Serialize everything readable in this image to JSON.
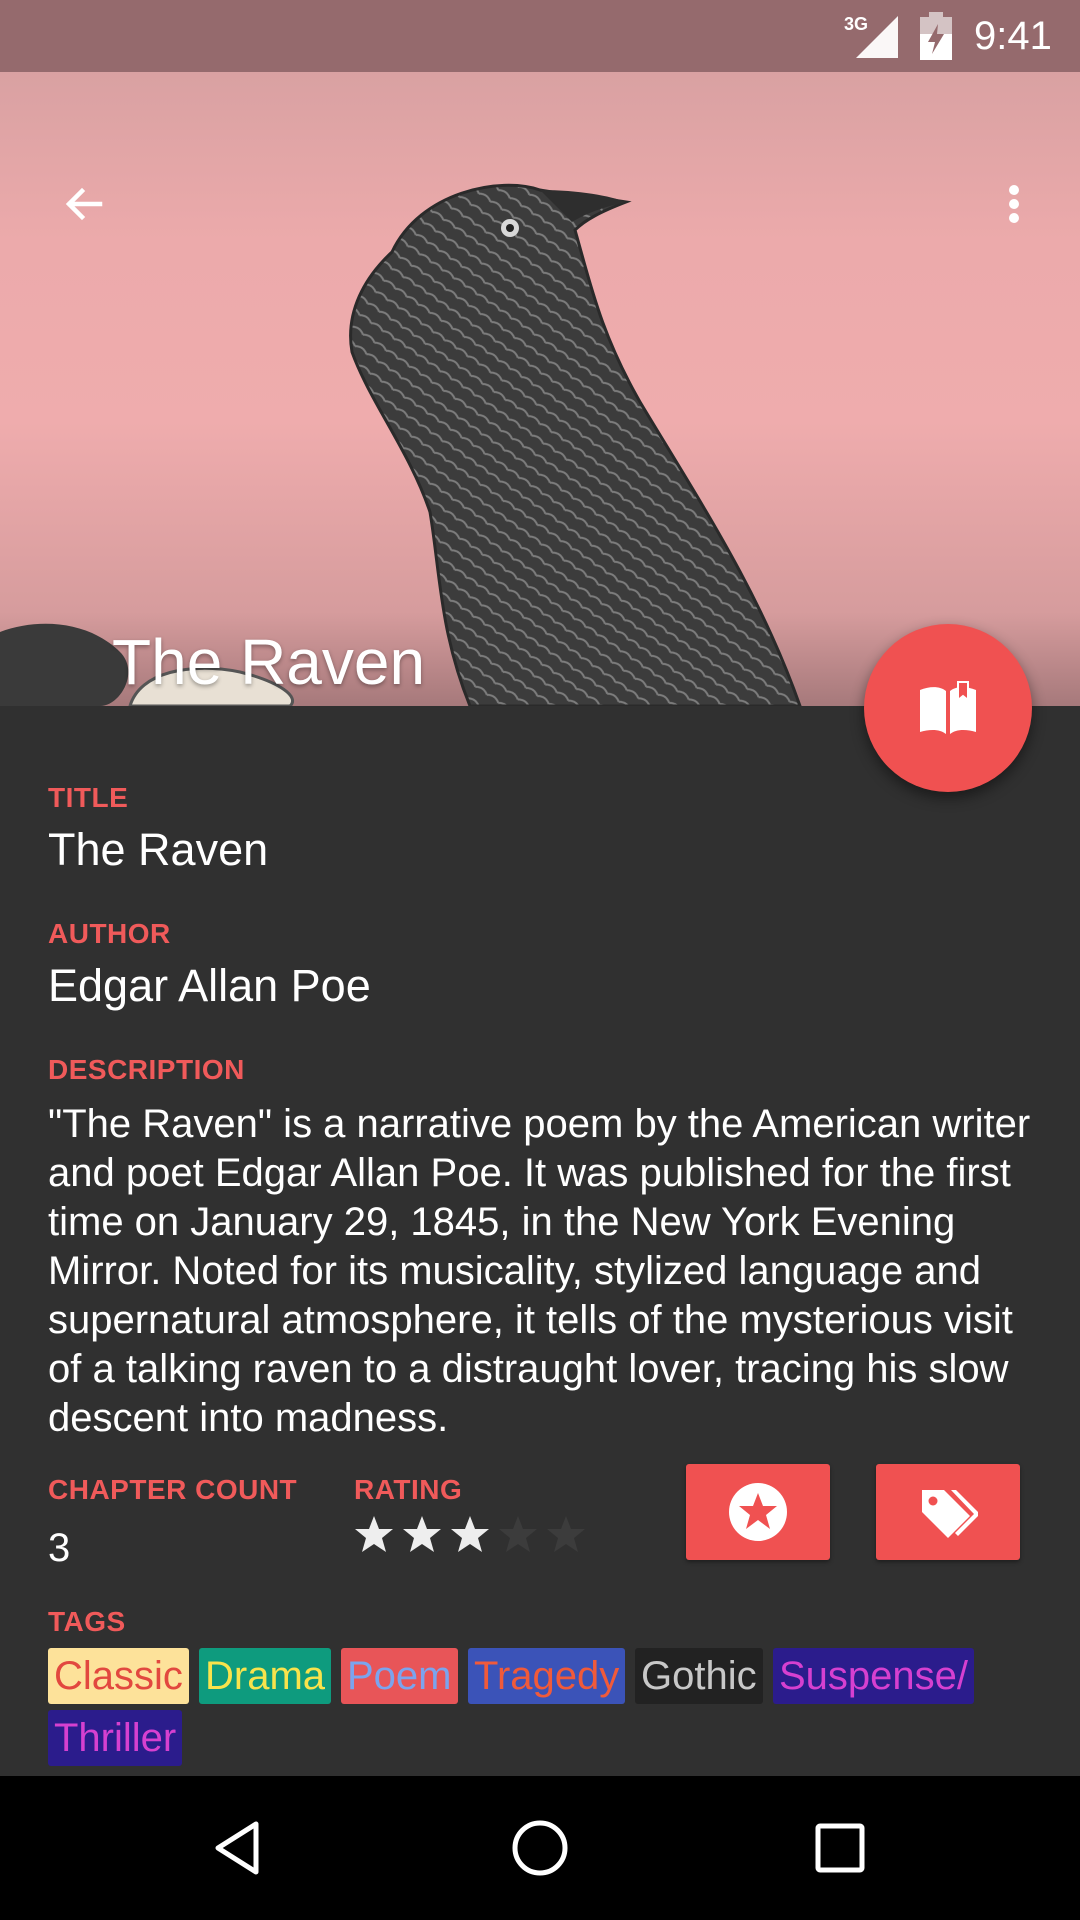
{
  "status_bar": {
    "network": "3G",
    "time": "9:41"
  },
  "header": {
    "title": "The Raven"
  },
  "book": {
    "title_label": "TITLE",
    "title": "The Raven",
    "author_label": "AUTHOR",
    "author": "Edgar Allan Poe",
    "description_label": "DESCRIPTION",
    "description": "\"The Raven\" is a narrative poem by the American writer and poet Edgar Allan Poe. It was published for the first time on January 29, 1845, in the New York Evening Mirror. Noted for its musicality, stylized language and supernatural atmosphere, it tells of the mysterious visit of a talking raven to a distraught lover, tracing his slow descent into madness.",
    "chapter_count_label": "CHAPTER COUNT",
    "chapter_count": "3",
    "rating_label": "RATING",
    "rating": 3,
    "rating_max": 5,
    "tags_label": "TAGS",
    "tags": [
      {
        "label": "Classic",
        "bg": "#fde29a",
        "fg": "#e2483f"
      },
      {
        "label": "Drama",
        "bg": "#0e9b7e",
        "fg": "#f8e34c"
      },
      {
        "label": "Poem",
        "bg": "#e85558",
        "fg": "#7ba4ee"
      },
      {
        "label": "Tragedy",
        "bg": "#3b53b8",
        "fg": "#f05a3a"
      },
      {
        "label": "Gothic",
        "bg": "#222222",
        "fg": "#c8c8c8"
      },
      {
        "label": "Suspense/",
        "bg": "#2b1c8c",
        "fg": "#d640d0"
      },
      {
        "label": "Thriller",
        "bg": "#2b1c8c",
        "fg": "#d640d0"
      }
    ]
  },
  "icons": {
    "back": "arrow-left-icon",
    "menu": "more-vert-icon",
    "read": "open-book-icon",
    "favorite": "star-circle-icon",
    "tags": "tags-icon",
    "nav_back": "triangle-back-icon",
    "nav_home": "circle-home-icon",
    "nav_recents": "square-recents-icon"
  },
  "colors": {
    "accent": "#f05151",
    "label": "#f05a5a",
    "background": "#303030",
    "status_bar": "#956a6d"
  }
}
